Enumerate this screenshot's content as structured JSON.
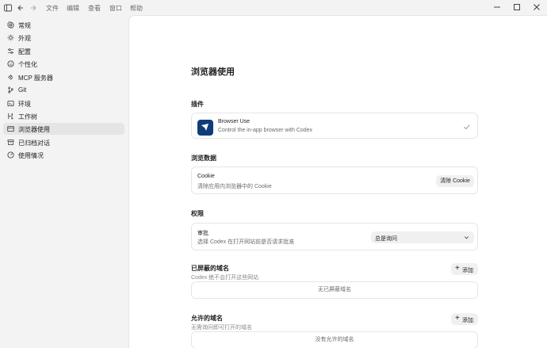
{
  "menu": [
    "文件",
    "编辑",
    "查看",
    "窗口",
    "帮助"
  ],
  "sidebar": {
    "items": [
      {
        "label": "常规",
        "icon": "gear-icon"
      },
      {
        "label": "外观",
        "icon": "sun-icon"
      },
      {
        "label": "配置",
        "icon": "sliders-icon"
      },
      {
        "label": "个性化",
        "icon": "smile-icon"
      },
      {
        "label": "MCP 服务器",
        "icon": "mcp-icon"
      },
      {
        "label": "Git",
        "icon": "git-icon"
      },
      {
        "label": "环境",
        "icon": "cloud-icon"
      },
      {
        "label": "工作树",
        "icon": "worktree-icon"
      },
      {
        "label": "浏览器使用",
        "icon": "browser-icon",
        "active": true
      },
      {
        "label": "已归档对话",
        "icon": "archive-icon"
      },
      {
        "label": "使用情况",
        "icon": "gauge-icon"
      }
    ]
  },
  "page": {
    "title": "浏览器使用"
  },
  "plugins": {
    "title": "插件",
    "name": "Browser Use",
    "desc": "Control the in-app browser with Codex"
  },
  "browser_data": {
    "title": "浏览数据",
    "name": "Cookie",
    "desc": "清除应用内浏览器中的 Cookie",
    "button": "清除 Cookie"
  },
  "permissions": {
    "title": "权限",
    "name": "审批",
    "desc": "选择 Codex 在打开网站前是否请求批准",
    "selected": "总是询问"
  },
  "blocked": {
    "title": "已屏蔽的域名",
    "desc": "Codex 绝不会打开这些网站",
    "add": "添加",
    "empty": "无已屏蔽域名"
  },
  "allowed": {
    "title": "允许的域名",
    "desc": "无需询问即可打开的域名",
    "add": "添加",
    "empty": "没有允许的域名"
  }
}
